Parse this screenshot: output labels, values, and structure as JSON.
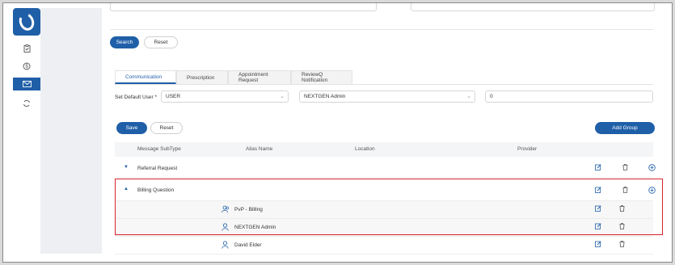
{
  "sidebar": {
    "items": [
      {
        "icon": "clipboard-check-icon"
      },
      {
        "icon": "dollar-icon"
      },
      {
        "icon": "envelope-icon"
      },
      {
        "icon": "sync-icon"
      }
    ]
  },
  "filters": {
    "search_label": "Search",
    "reset_label": "Reset"
  },
  "tabs": [
    {
      "label": "Communication",
      "active": true
    },
    {
      "label": "Prescription",
      "active": false
    },
    {
      "label": "Appointment Request",
      "active": false
    },
    {
      "label": "ReviewQ Notification",
      "active": false
    }
  ],
  "settings": {
    "default_user_label": "Set Default User *",
    "default_user_value": "USER",
    "provider_value": "NEXTGEN Admin",
    "count_value": "0"
  },
  "actions": {
    "save_label": "Save",
    "reset_label": "Reset",
    "add_group_label": "Add Group"
  },
  "table": {
    "columns": [
      "Message SubType",
      "Alias Name",
      "Location",
      "Provider"
    ],
    "rows": [
      {
        "subtype": "Referral Request",
        "expanded": false
      },
      {
        "subtype": "Billing Question",
        "expanded": true
      },
      {
        "alias": "PvP - Billing",
        "icon": "group-user-icon"
      },
      {
        "alias": "NEXTGEN Admin",
        "icon": "user-icon"
      },
      {
        "alias": "David Elder",
        "icon": "user-icon"
      }
    ]
  },
  "colors": {
    "primary": "#1f5fa8",
    "highlight_border": "#d9242b"
  }
}
